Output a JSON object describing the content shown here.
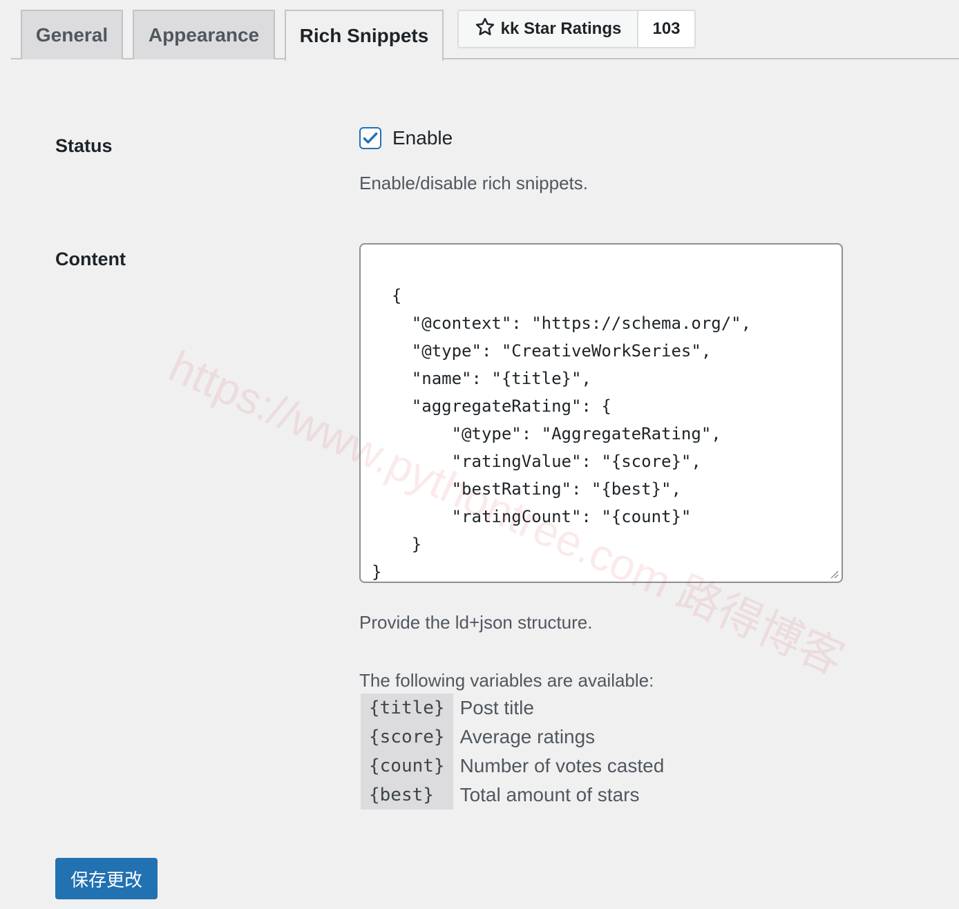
{
  "tabs": [
    {
      "label": "General",
      "active": false
    },
    {
      "label": "Appearance",
      "active": false
    },
    {
      "label": "Rich Snippets",
      "active": true
    }
  ],
  "plugin_badge": {
    "icon": "star-outline-icon",
    "name": "kk Star Ratings",
    "count": "103"
  },
  "status": {
    "label": "Status",
    "checkbox_label": "Enable",
    "checked": true,
    "description": "Enable/disable rich snippets."
  },
  "content": {
    "label": "Content",
    "json_template": "{\n    \"@context\": \"https://schema.org/\",\n    \"@type\": \"CreativeWorkSeries\",\n    \"name\": \"{title}\",\n    \"aggregateRating\": {\n        \"@type\": \"AggregateRating\",\n        \"ratingValue\": \"{score}\",\n        \"bestRating\": \"{best}\",\n        \"ratingCount\": \"{count}\"\n    }\n}",
    "description": "Provide the ld+json structure.",
    "variables_intro": "The following variables are available:",
    "variables": [
      {
        "code": "{title}",
        "desc": "Post title"
      },
      {
        "code": "{score}",
        "desc": "Average ratings"
      },
      {
        "code": "{count}",
        "desc": "Number of votes casted"
      },
      {
        "code": "{best}",
        "desc": "Total amount of stars"
      }
    ]
  },
  "save_button": "保存更改",
  "watermark": "https://www.pythontree.com 路得博客",
  "colors": {
    "accent": "#2271b1",
    "background": "#f0f0f1"
  }
}
